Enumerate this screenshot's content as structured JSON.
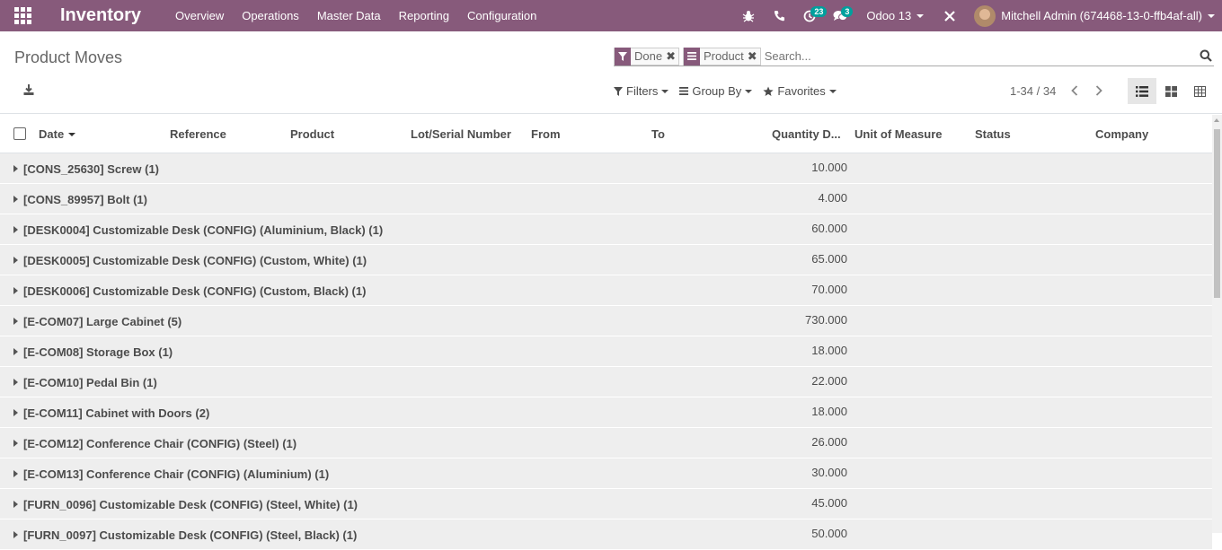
{
  "navbar": {
    "app_name": "Inventory",
    "menu": [
      "Overview",
      "Operations",
      "Master Data",
      "Reporting",
      "Configuration"
    ],
    "activities_count": "23",
    "messages_count": "3",
    "database": "Odoo 13",
    "user": "Mitchell Admin (674468-13-0-ffb4af-all)",
    "brand_color": "#875a7b",
    "badge_color": "#00a09d"
  },
  "control": {
    "title": "Product Moves",
    "facets": [
      {
        "icon": "filter-icon",
        "label": "Done"
      },
      {
        "icon": "group-by-icon",
        "label": "Product"
      }
    ],
    "search_placeholder": "Search...",
    "filters_label": "Filters",
    "group_by_label": "Group By",
    "favorites_label": "Favorites",
    "pager": "1-34 / 34"
  },
  "table": {
    "columns": [
      "Date",
      "Reference",
      "Product",
      "Lot/Serial Number",
      "From",
      "To",
      "Quantity D...",
      "Unit of Measure",
      "Status",
      "Company"
    ],
    "groups": [
      {
        "label": "[CONS_25630] Screw (1)",
        "qty": "10.000"
      },
      {
        "label": "[CONS_89957] Bolt (1)",
        "qty": "4.000"
      },
      {
        "label": "[DESK0004] Customizable Desk (CONFIG) (Aluminium, Black) (1)",
        "qty": "60.000"
      },
      {
        "label": "[DESK0005] Customizable Desk (CONFIG) (Custom, White) (1)",
        "qty": "65.000"
      },
      {
        "label": "[DESK0006] Customizable Desk (CONFIG) (Custom, Black) (1)",
        "qty": "70.000"
      },
      {
        "label": "[E-COM07] Large Cabinet (5)",
        "qty": "730.000"
      },
      {
        "label": "[E-COM08] Storage Box (1)",
        "qty": "18.000"
      },
      {
        "label": "[E-COM10] Pedal Bin (1)",
        "qty": "22.000"
      },
      {
        "label": "[E-COM11] Cabinet with Doors (2)",
        "qty": "18.000"
      },
      {
        "label": "[E-COM12] Conference Chair (CONFIG) (Steel) (1)",
        "qty": "26.000"
      },
      {
        "label": "[E-COM13] Conference Chair (CONFIG) (Aluminium) (1)",
        "qty": "30.000"
      },
      {
        "label": "[FURN_0096] Customizable Desk (CONFIG) (Steel, White) (1)",
        "qty": "45.000"
      },
      {
        "label": "[FURN_0097] Customizable Desk (CONFIG) (Steel, Black) (1)",
        "qty": "50.000"
      }
    ]
  }
}
